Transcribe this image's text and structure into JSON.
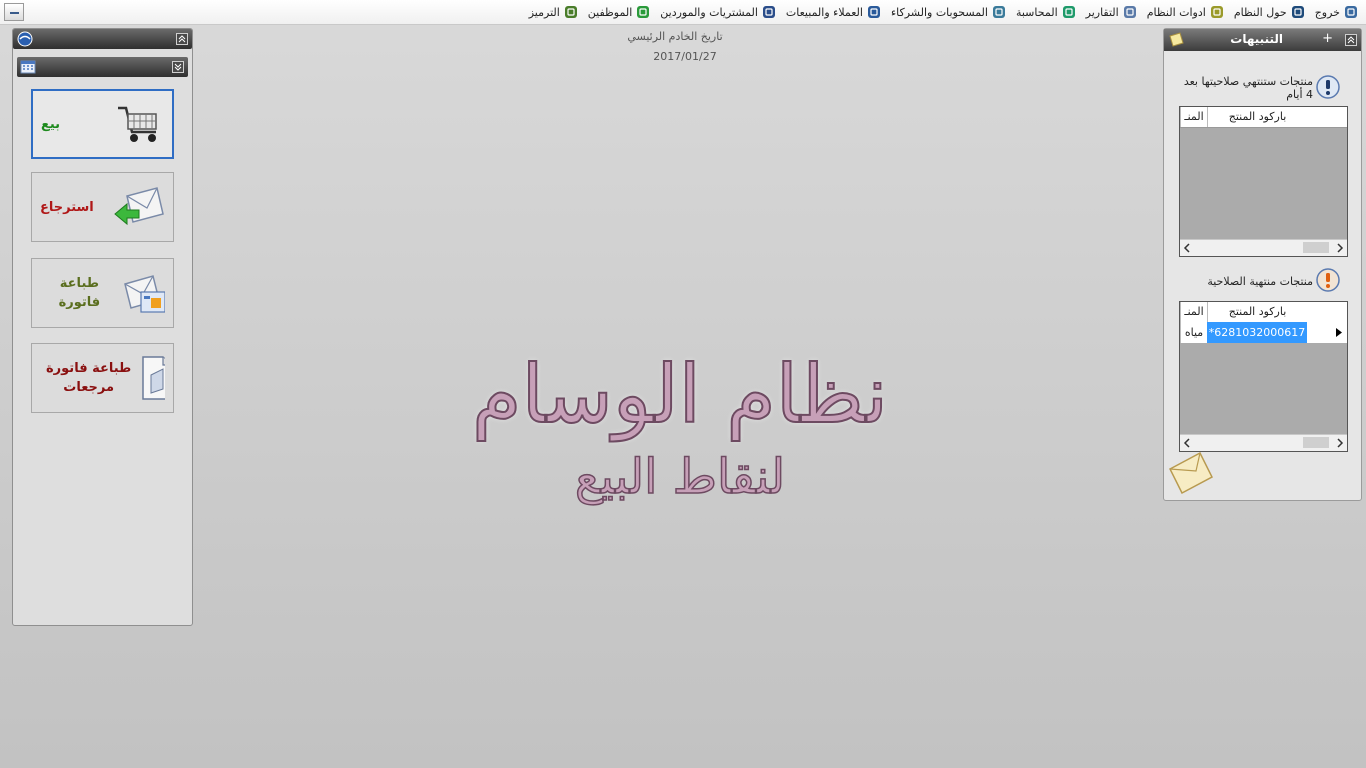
{
  "menu": [
    {
      "label": "الترميز",
      "icon": "coding-icon",
      "color": "#4a7d2a"
    },
    {
      "label": "الموظفين",
      "icon": "employees-icon",
      "color": "#2a9a3a"
    },
    {
      "label": "المشتريات والموردين",
      "icon": "purchases-icon",
      "color": "#2a4d8a"
    },
    {
      "label": "العملاء والمبيعات",
      "icon": "customers-icon",
      "color": "#2a5a9a"
    },
    {
      "label": "المسحوبات والشركاء",
      "icon": "withdrawals-icon",
      "color": "#3a7a9a"
    },
    {
      "label": "المحاسبة",
      "icon": "accounting-icon",
      "color": "#1e9a6a"
    },
    {
      "label": "التقارير",
      "icon": "reports-icon",
      "color": "#5a7aa8"
    },
    {
      "label": "ادوات النظام",
      "icon": "tools-icon",
      "color": "#9a9a2a"
    },
    {
      "label": "حول النظام",
      "icon": "about-icon",
      "color": "#1e4a7a"
    },
    {
      "label": "خروج",
      "icon": "exit-icon",
      "color": "#3a6aa0"
    }
  ],
  "left_panel": {
    "buttons": [
      {
        "label": "بيع",
        "color": "#1d8a1d",
        "icon": "cart-icon"
      },
      {
        "label": "استرجاع",
        "color": "#b01818",
        "icon": "return-mail-icon"
      },
      {
        "label": "طباعة فاتورة",
        "color": "#5a6e1e",
        "icon": "print-invoice-icon"
      },
      {
        "label": "طباعة فاتورة مرجعات",
        "color": "#8a1010",
        "icon": "print-returns-icon"
      }
    ]
  },
  "center": {
    "server_date_label": "تاريخ الخادم الرئيسي",
    "server_date": "2017/01/27",
    "title": "نظام الوسام",
    "subtitle": "لنقاط البيع"
  },
  "alerts": {
    "title": "التنبيهات",
    "soon_expiring_caption": "منتجات ستنتهي صلاحيتها بعد 4 أيام",
    "expired_caption": "منتجات منتهية الصلاحية",
    "col_barcode": "باركود المنتج",
    "col_name": "المنـ",
    "expired_rows": [
      {
        "barcode": "*6281032000617",
        "name": "مياه"
      }
    ]
  }
}
